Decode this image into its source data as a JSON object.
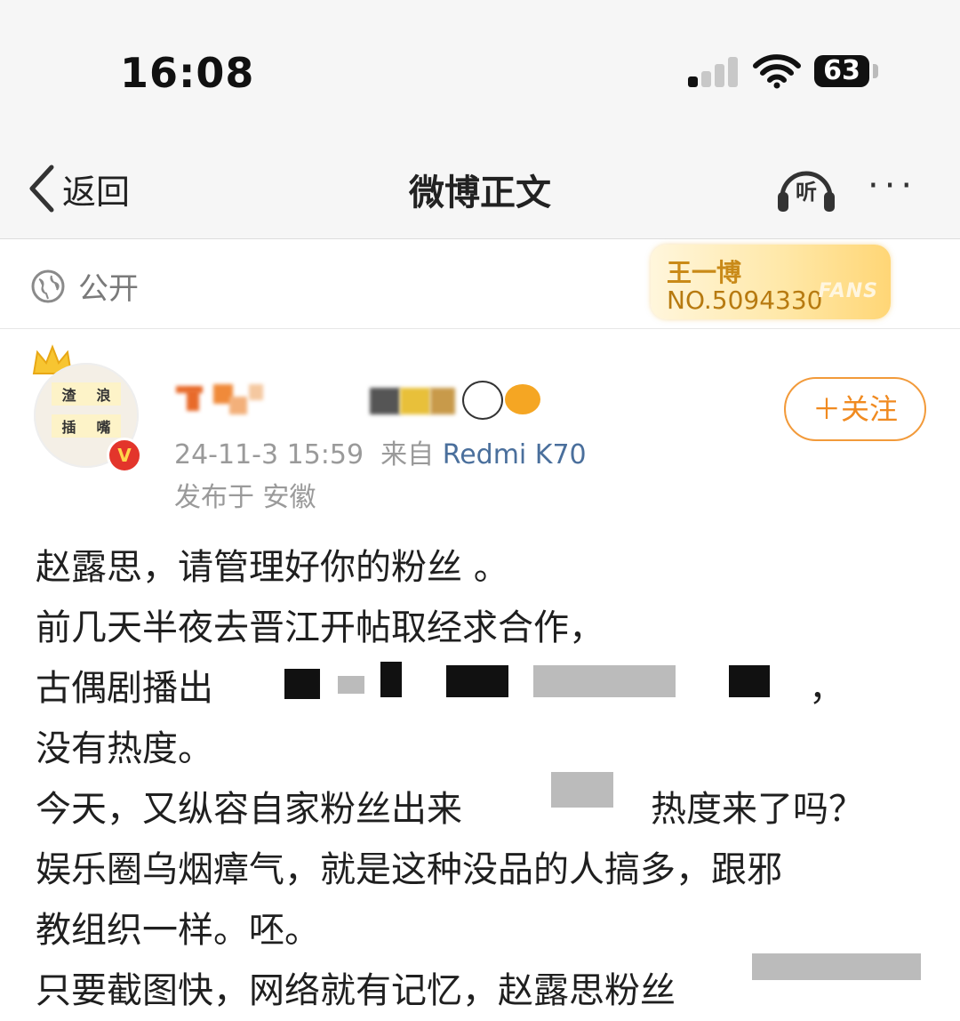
{
  "status_bar": {
    "time": "16:08",
    "battery": "63"
  },
  "nav": {
    "back_label": "返回",
    "title": "微博正文",
    "listen_label": "听",
    "more_label": "···"
  },
  "visibility": {
    "label": "公开"
  },
  "fan_badge": {
    "name": "王一博",
    "number": "NO.5094330",
    "tag": "FANS"
  },
  "avatar": {
    "chars": [
      "渣",
      "浪",
      "插",
      "嘴"
    ],
    "verified": "V"
  },
  "post": {
    "date": "24-11-3 15:59",
    "source_prefix": "来自",
    "source": "Redmi K70",
    "location": "发布于 安徽",
    "follow_label": "＋关注",
    "lines": [
      "赵露思，请管理好你的粉丝 。",
      "前几天半夜去晋江开帖取经求合作，",
      "古偶剧播出",
      "没有热度。",
      "今天，又纵容自家粉丝出来",
      "娱乐圈乌烟瘴气，就是这种没品的人搞多，跟邪",
      "教组织一样。呸。",
      "只要截图快，网络就有记忆，赵露思粉丝"
    ],
    "line3_tail": "，",
    "line5_tail": "热度来了吗？"
  }
}
